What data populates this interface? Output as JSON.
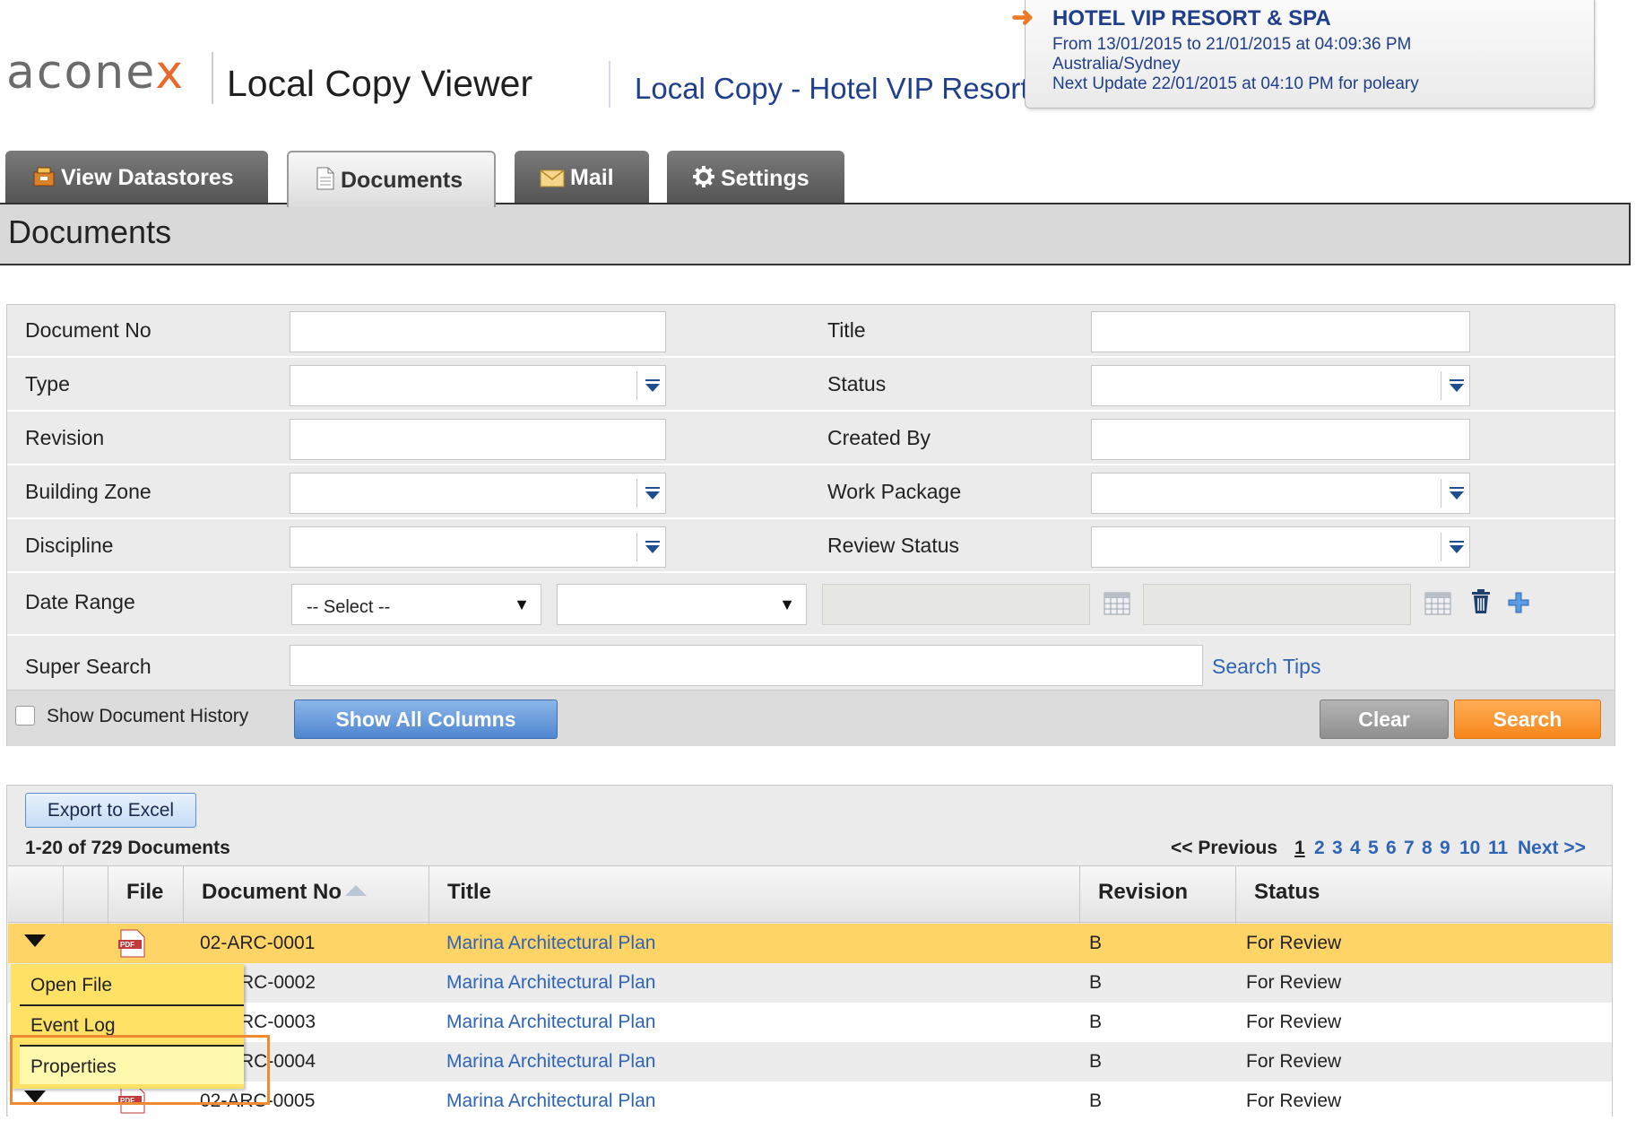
{
  "header": {
    "logo": "aconex",
    "app_title": "Local Copy Viewer",
    "project_link": "Local Copy - Hotel VIP Resort"
  },
  "project_info": {
    "name": "HOTEL VIP RESORT & SPA",
    "date_range": "From 13/01/2015 to 21/01/2015 at 04:09:36 PM",
    "timezone": "Australia/Sydney",
    "next_update": "Next Update 22/01/2015 at 04:10 PM for poleary"
  },
  "tabs": [
    {
      "label": "View  Datastores",
      "icon": "datastore-icon"
    },
    {
      "label": "Documents",
      "icon": "document-icon"
    },
    {
      "label": "Mail",
      "icon": "mail-icon"
    },
    {
      "label": "Settings",
      "icon": "gear-icon"
    }
  ],
  "page_title": "Documents",
  "search": {
    "labels": {
      "document_no": "Document No",
      "title": "Title",
      "type": "Type",
      "status": "Status",
      "revision": "Revision",
      "created_by": "Created By",
      "building_zone": "Building Zone",
      "work_package": "Work Package",
      "discipline": "Discipline",
      "review_status": "Review Status",
      "date_range": "Date Range",
      "super_search": "Super Search"
    },
    "date_range_select": "-- Select --",
    "date_range_select2": "",
    "search_tips": "Search Tips",
    "show_history_label": "Show Document History",
    "show_history_checked": false,
    "show_all_columns": "Show All Columns",
    "clear": "Clear",
    "search": "Search"
  },
  "results": {
    "export": "Export to Excel",
    "count": "1-20 of 729  Documents",
    "pager": {
      "previous": "<< Previous",
      "current": "1",
      "pages": [
        "2",
        "3",
        "4",
        "5",
        "6",
        "7",
        "8",
        "9",
        "10",
        "11"
      ],
      "next": "Next >>"
    },
    "columns": [
      "File",
      "Document No",
      "Title",
      "Revision",
      "Status"
    ],
    "rows": [
      {
        "doc_no": "02-ARC-0001",
        "title": "Marina Architectural Plan",
        "revision": "B",
        "status": "For Review"
      },
      {
        "doc_no": "RC-0002",
        "title": "Marina Architectural Plan",
        "revision": "B",
        "status": "For Review"
      },
      {
        "doc_no": "RC-0003",
        "title": "Marina Architectural Plan",
        "revision": "B",
        "status": "For Review"
      },
      {
        "doc_no": "RC-0004",
        "title": "Marina Architectural Plan",
        "revision": "B",
        "status": "For Review"
      },
      {
        "doc_no": "02-ARC-0005",
        "title": "Marina Architectural Plan",
        "revision": "B",
        "status": "For Review"
      }
    ]
  },
  "context_menu": {
    "items": [
      "Open File",
      "Event Log",
      "Properties"
    ]
  },
  "colors": {
    "selected_row": "#ffd466",
    "link": "#2e64b5",
    "brand_orange": "#e8692b",
    "callout": "#ef8a33"
  }
}
